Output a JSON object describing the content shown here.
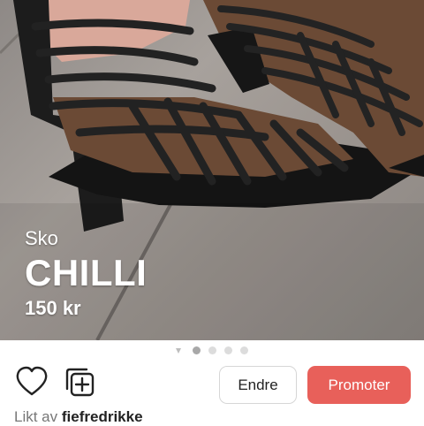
{
  "listing": {
    "category": "Sko",
    "brand": "CHILLI",
    "price": "150 kr"
  },
  "carousel": {
    "dot_count": 4,
    "active_index": 0
  },
  "actions": {
    "edit_label": "Endre",
    "promote_label": "Promoter",
    "like_icon": "heart-icon",
    "add_photo_icon": "add-photo-icon"
  },
  "likes": {
    "prefix": "Likt av",
    "user": "fiefredrikke"
  },
  "colors": {
    "accent": "#e8605a",
    "text_dark": "#222222",
    "text_muted": "#777777"
  }
}
